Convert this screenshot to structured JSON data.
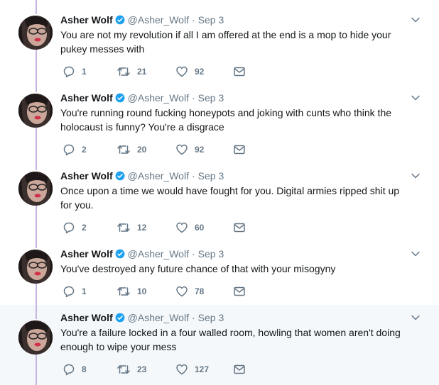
{
  "author": {
    "name": "Asher Wolf",
    "handle": "@Asher_Wolf",
    "separator": "·",
    "verified": true
  },
  "colors": {
    "thread_line": "#c4b5e3",
    "verified": "#1da1f2",
    "muted": "#657786",
    "highlight_bg": "#f5f8fa"
  },
  "tweets": [
    {
      "date": "Sep 3",
      "text": "You are not my revolution if all I am offered at the end is a mop to hide your pukey messes with",
      "replies": "1",
      "retweets": "21",
      "likes": "92"
    },
    {
      "date": "Sep 3",
      "text": "You're running round fucking honeypots and joking with cunts who think the holocaust is funny? You're a disgrace",
      "replies": "2",
      "retweets": "20",
      "likes": "92"
    },
    {
      "date": "Sep 3",
      "text": "Once upon a time we would have fought for you. Digital armies ripped shit up for you.",
      "replies": "2",
      "retweets": "12",
      "likes": "60"
    },
    {
      "date": "Sep 3",
      "text": "You've destroyed any future chance of that with your misogyny",
      "replies": "1",
      "retweets": "10",
      "likes": "78"
    },
    {
      "date": "Sep 3",
      "text": "You're a failure locked in a four walled room, howling that women aren't doing enough to wipe your mess",
      "replies": "8",
      "retweets": "23",
      "likes": "127"
    }
  ]
}
